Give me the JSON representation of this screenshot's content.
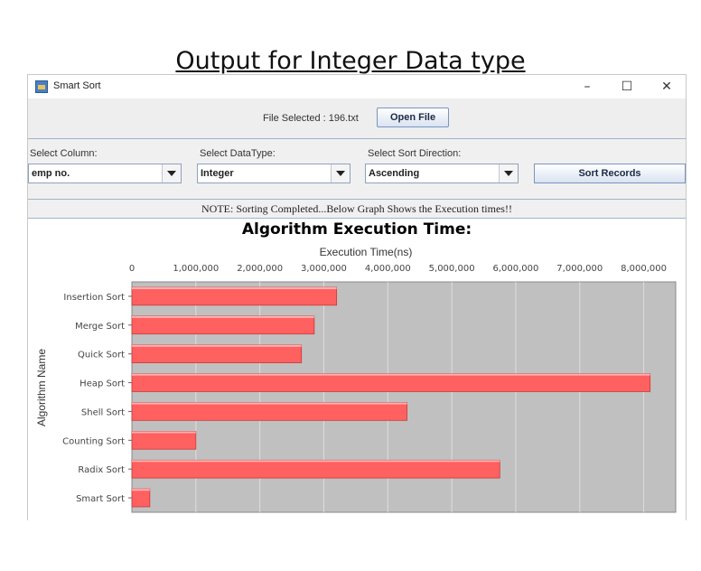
{
  "slide": {
    "title": "Output for Integer Data type"
  },
  "window": {
    "title": "Smart Sort",
    "minimize": "–",
    "maximize": "☐",
    "close": "✕"
  },
  "file_row": {
    "label": "File Selected : 196.txt",
    "open_button": "Open File"
  },
  "controls": {
    "column_label": "Select Column:",
    "column_value": "emp no.",
    "datatype_label": "Select DataType:",
    "datatype_value": "Integer",
    "direction_label": "Select Sort Direction:",
    "direction_value": "Ascending",
    "sort_button": "Sort Records"
  },
  "note": "NOTE: Sorting Completed...Below Graph Shows the Execution times!!",
  "chart_data": {
    "type": "bar",
    "orientation": "horizontal",
    "title": "Algorithm Execution Time:",
    "xlabel": "Execution Time(ns)",
    "ylabel": "Algorithm Name",
    "xlim": [
      0,
      8500000
    ],
    "x_ticks": [
      "0",
      "1,000,000",
      "2,000,000",
      "3,000,000",
      "4,000,000",
      "5,000,000",
      "6,000,000",
      "7,000,000",
      "8,000,000"
    ],
    "categories": [
      "Insertion Sort",
      "Merge Sort",
      "Quick Sort",
      "Heap Sort",
      "Shell Sort",
      "Counting Sort",
      "Radix Sort",
      "Smart Sort"
    ],
    "values": [
      3200000,
      2850000,
      2650000,
      8100000,
      4300000,
      1000000,
      5750000,
      280000
    ],
    "bar_color": "#ff6060",
    "plot_background": "#c0c0c0",
    "grid": true
  }
}
